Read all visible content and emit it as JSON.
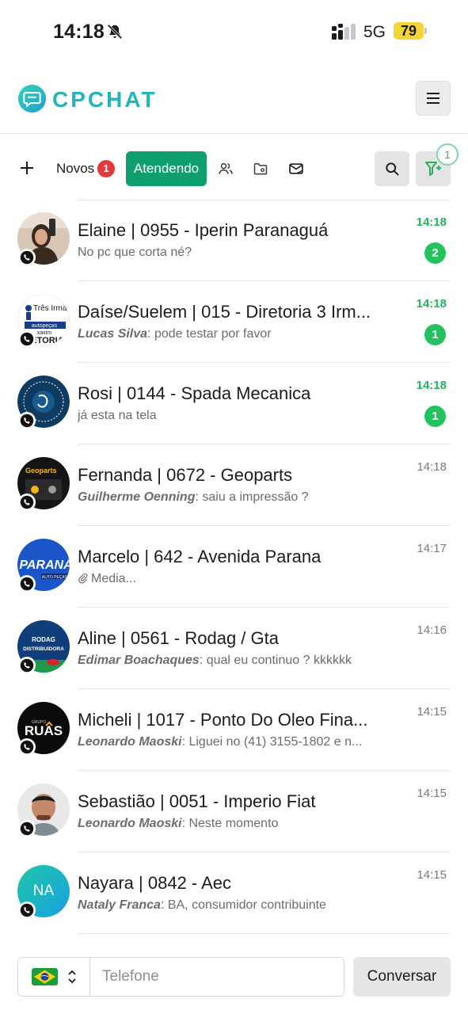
{
  "status_bar": {
    "time": "14:18",
    "network": "5G",
    "battery": "79"
  },
  "header": {
    "brand": "CPCHAT",
    "brand_color": "#22b5b9",
    "menu_icon": "hamburger-icon"
  },
  "toolbar": {
    "novos_label": "Novos",
    "novos_count": "1",
    "atendendo_label": "Atendendo",
    "filter_count": "1",
    "accent": "#0f9e6e"
  },
  "chats": [
    {
      "name": "Elaine | 0955 - Iperin Paranaguá",
      "author": "",
      "message": "No pc que corta né?",
      "time": "14:18",
      "unread": "2"
    },
    {
      "name": "Daíse/Suelem | 015 - Diretoria 3 Irm...",
      "author": "Lucas Silva",
      "message": ": pode testar por favor",
      "time": "14:18",
      "unread": "1"
    },
    {
      "name": "Rosi | 0144 - Spada Mecanica",
      "author": "",
      "message": "já esta na tela",
      "time": "14:18",
      "unread": "1"
    },
    {
      "name": "Fernanda | 0672 - Geoparts",
      "author": "Guilherme Oenning",
      "message": ": saiu a impressão ?",
      "time": "14:18",
      "unread": ""
    },
    {
      "name": "Marcelo | 642 - Avenida Parana",
      "author": "",
      "message": "Media...",
      "time": "14:17",
      "unread": ""
    },
    {
      "name": "Aline | 0561 - Rodag / Gta",
      "author": "Edimar Boachaques",
      "message": ": qual eu continuo ? kkkkkk",
      "time": "14:16",
      "unread": ""
    },
    {
      "name": "Micheli | 1017 - Ponto Do Oleo Fina...",
      "author": "Leonardo Maoski",
      "message": ": Liguei no (41) 3155-1802 e n...",
      "time": "14:15",
      "unread": ""
    },
    {
      "name": "Sebastião | 0051 - Imperio Fiat",
      "author": "Leonardo Maoski",
      "message": ": Neste momento",
      "time": "14:15",
      "unread": ""
    },
    {
      "name": "Nayara | 0842 - Aec",
      "author": "Nataly Franca",
      "message": ": BA, consumidor contribuinte",
      "time": "14:15",
      "unread": ""
    }
  ],
  "avatars": {
    "chat_2_text": "Três Irmãos",
    "chat_2_sub": "autopeças",
    "chat_2_sub2": "xaxim",
    "chat_2_sub3": "RETORIA",
    "chat_4_text": "Geoparts",
    "chat_5_text": "PARANÁ",
    "chat_5_sub": "AUTO PEÇAS",
    "chat_6_text": "RODAG",
    "chat_6_sub": "DISTRIBUIDORA",
    "chat_7_text": "RUAS",
    "chat_7_sub": "GRUPO",
    "chat_9_initials": "NA"
  },
  "bottom_bar": {
    "phone_placeholder": "Telefone",
    "send_label": "Conversar",
    "country": "Brazil"
  }
}
